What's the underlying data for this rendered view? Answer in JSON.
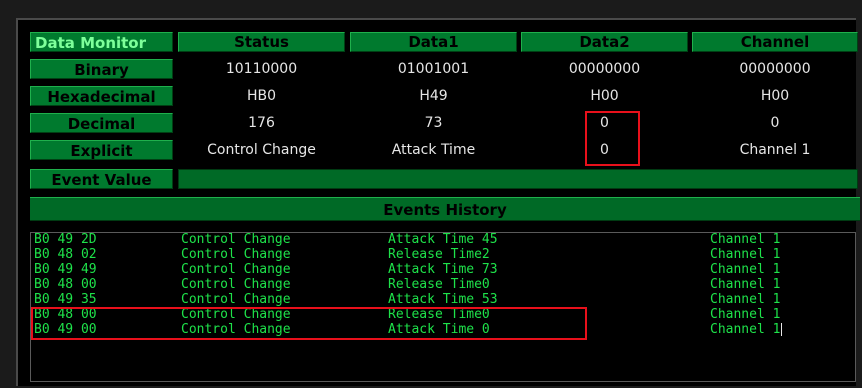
{
  "columns": {
    "corner": "Data Monitor",
    "status": "Status",
    "data1": "Data1",
    "data2": "Data2",
    "channel": "Channel"
  },
  "rows": [
    {
      "label": "Binary",
      "status": "10110000",
      "data1": "01001001",
      "data2": "00000000",
      "channel": "00000000"
    },
    {
      "label": "Hexadecimal",
      "status": "HB0",
      "data1": "H49",
      "data2": "H00",
      "channel": "H00"
    },
    {
      "label": "Decimal",
      "status": "176",
      "data1": "73",
      "data2": "0",
      "channel": "0"
    },
    {
      "label": "Explicit",
      "status": "Control Change",
      "data1": "Attack Time",
      "data2": "0",
      "channel": "Channel 1"
    }
  ],
  "event_value_label": "Event Value",
  "history_title": "Events History",
  "history": [
    {
      "hex": "B0 49 2D",
      "type": "Control Change",
      "param": "Attack Time 45",
      "channel": "Channel 1"
    },
    {
      "hex": "B0 48 02",
      "type": "Control Change",
      "param": "Release Time2",
      "channel": "Channel 1"
    },
    {
      "hex": "B0 49 49",
      "type": "Control Change",
      "param": "Attack Time 73",
      "channel": "Channel 1"
    },
    {
      "hex": "B0 48 00",
      "type": "Control Change",
      "param": "Release Time0",
      "channel": "Channel 1"
    },
    {
      "hex": "B0 49 35",
      "type": "Control Change",
      "param": "Attack Time 53",
      "channel": "Channel 1"
    },
    {
      "hex": "B0 48 00",
      "type": "Control Change",
      "param": "Release Time0",
      "channel": "Channel 1"
    },
    {
      "hex": "B0 49 00",
      "type": "Control Change",
      "param": "Attack Time 0",
      "channel": "Channel 1"
    }
  ],
  "colors": {
    "header_green": "#007a2e",
    "history_text": "#1ee24a",
    "highlight_red": "#e8101b"
  }
}
